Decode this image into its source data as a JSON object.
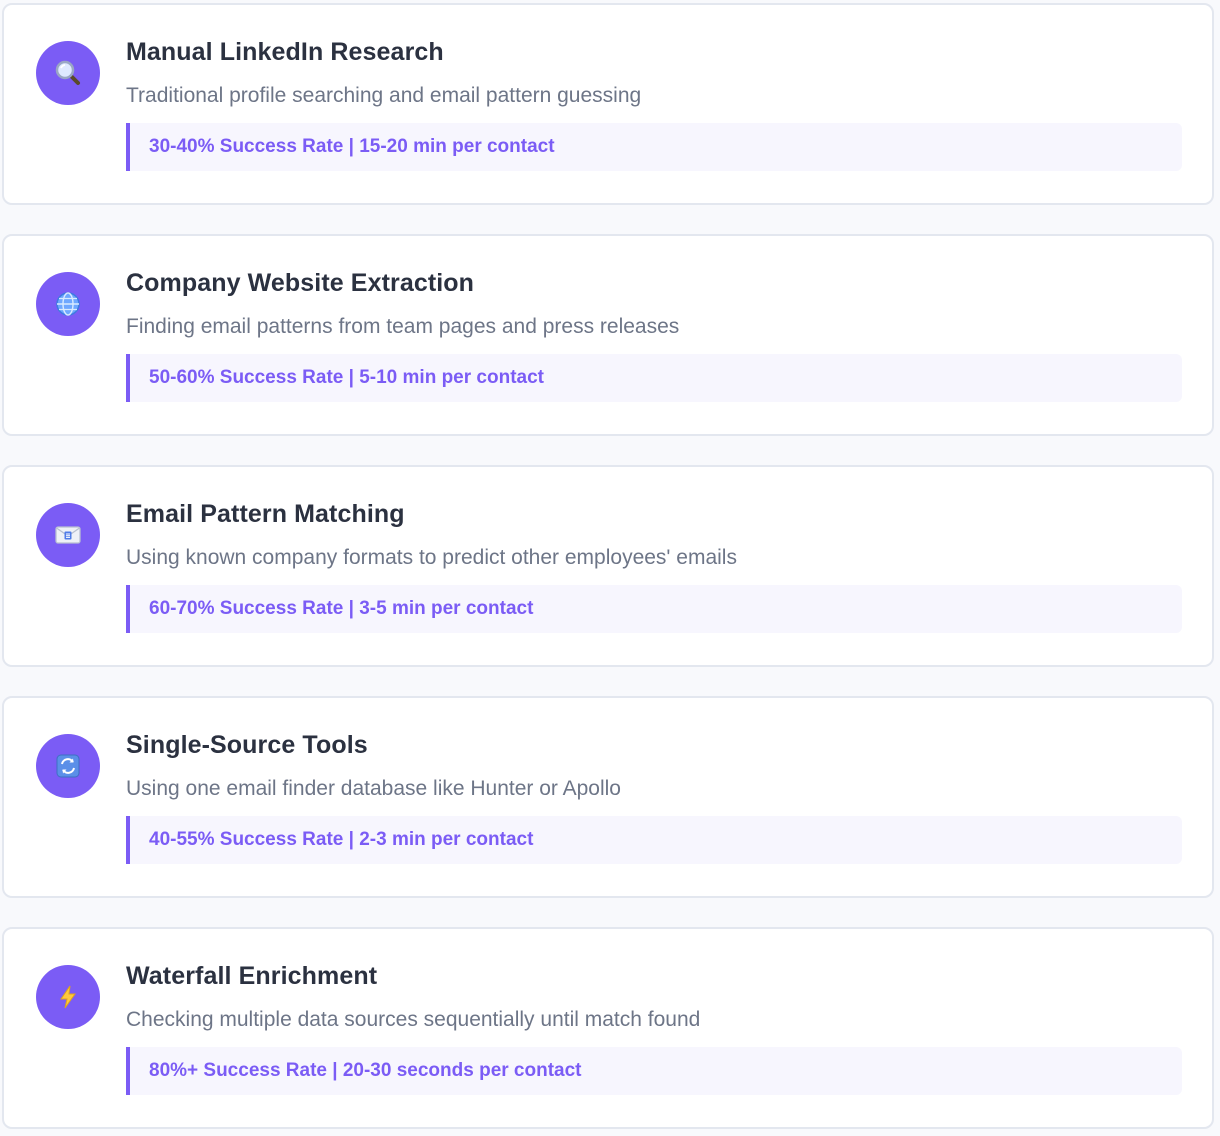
{
  "accent_color": "#7b5cf5",
  "methods": [
    {
      "icon": "magnifier-icon",
      "title": "Manual LinkedIn Research",
      "description": "Traditional profile searching and email pattern guessing",
      "stat": "30-40% Success Rate | 15-20 min per contact"
    },
    {
      "icon": "globe-icon",
      "title": "Company Website Extraction",
      "description": "Finding email patterns from team pages and press releases",
      "stat": "50-60% Success Rate | 5-10 min per contact"
    },
    {
      "icon": "envelope-icon",
      "title": "Email Pattern Matching",
      "description": "Using known company formats to predict other employees' emails",
      "stat": "60-70% Success Rate | 3-5 min per contact"
    },
    {
      "icon": "refresh-icon",
      "title": "Single-Source Tools",
      "description": "Using one email finder database like Hunter or Apollo",
      "stat": "40-55% Success Rate | 2-3 min per contact"
    },
    {
      "icon": "lightning-icon",
      "title": "Waterfall Enrichment",
      "description": "Checking multiple data sources sequentially until match found",
      "stat": "80%+ Success Rate | 20-30 seconds per contact"
    }
  ]
}
